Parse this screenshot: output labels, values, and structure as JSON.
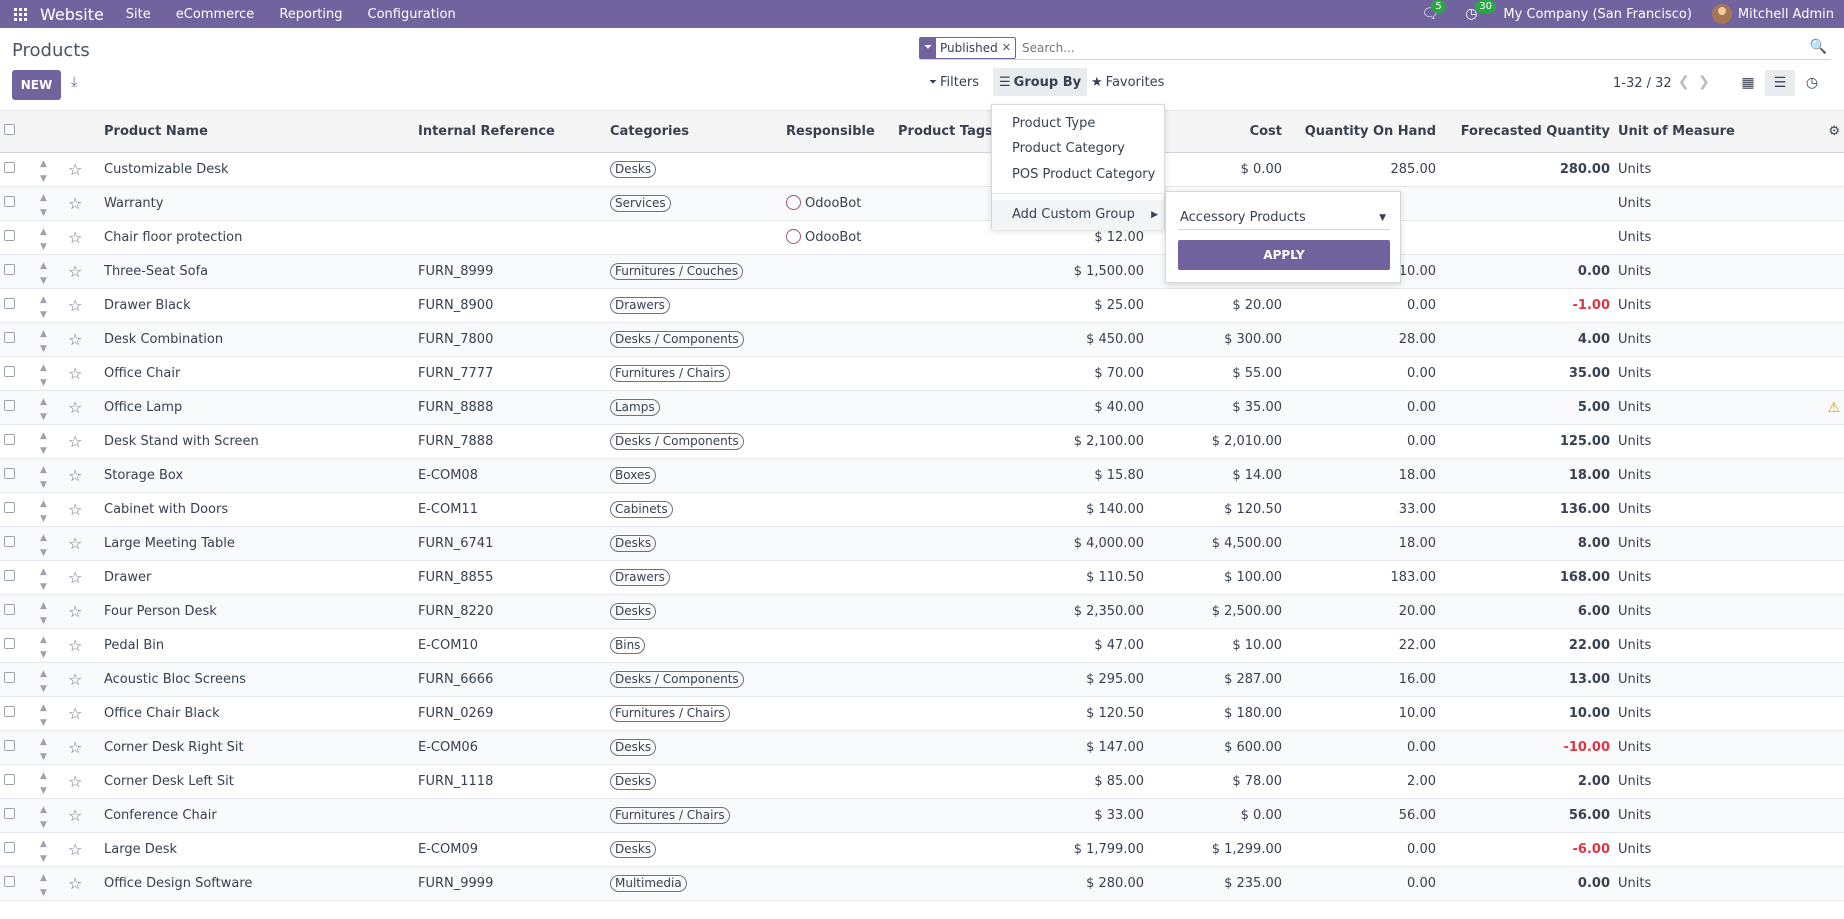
{
  "topbar": {
    "brand": "Website",
    "menus": [
      "Site",
      "eCommerce",
      "Reporting",
      "Configuration"
    ],
    "chat_count": "5",
    "activity_count": "30",
    "company": "My Company (San Francisco)",
    "user": "Mitchell Admin"
  },
  "control": {
    "title": "Products",
    "new_label": "NEW",
    "facet_label": "Published",
    "search_placeholder": "Search...",
    "filters_label": "Filters",
    "groupby_label": "Group By",
    "favorites_label": "Favorites",
    "pager": "1-32 / 32"
  },
  "columns": {
    "name": "Product Name",
    "ref": "Internal Reference",
    "categ": "Categories",
    "resp": "Responsible",
    "tags": "Product Tags",
    "cost": "Cost",
    "qty": "Quantity On Hand",
    "forecast": "Forecasted Quantity",
    "uom": "Unit of Measure"
  },
  "rows": [
    {
      "name": "Customizable Desk",
      "ref": "",
      "categ": "Desks",
      "resp": "",
      "price": "",
      "cost": "$ 0.00",
      "qty": "285.00",
      "forecast": "280.00",
      "fneg": false,
      "uom": "Units",
      "warn": false
    },
    {
      "name": "Warranty",
      "ref": "",
      "categ": "Services",
      "resp": "OdooBot",
      "price": "",
      "cost": "",
      "qty": "",
      "forecast": "",
      "fneg": false,
      "uom": "Units",
      "warn": false
    },
    {
      "name": "Chair floor protection",
      "ref": "",
      "categ": "",
      "resp": "OdooBot",
      "price": "$ 12.00",
      "cost": "",
      "qty": "",
      "forecast": "",
      "fneg": false,
      "uom": "Units",
      "warn": false
    },
    {
      "name": "Three-Seat Sofa",
      "ref": "FURN_8999",
      "categ": "Furnitures / Couches",
      "resp": "",
      "price": "$ 1,500.00",
      "cost": "",
      "qty": "10.00",
      "forecast": "0.00",
      "fneg": false,
      "uom": "Units",
      "warn": false
    },
    {
      "name": "Drawer Black",
      "ref": "FURN_8900",
      "categ": "Drawers",
      "resp": "",
      "price": "$ 25.00",
      "cost": "$ 20.00",
      "qty": "0.00",
      "forecast": "-1.00",
      "fneg": true,
      "uom": "Units",
      "warn": false
    },
    {
      "name": "Desk Combination",
      "ref": "FURN_7800",
      "categ": "Desks / Components",
      "resp": "",
      "price": "$ 450.00",
      "cost": "$ 300.00",
      "qty": "28.00",
      "forecast": "4.00",
      "fneg": false,
      "uom": "Units",
      "warn": false
    },
    {
      "name": "Office Chair",
      "ref": "FURN_7777",
      "categ": "Furnitures / Chairs",
      "resp": "",
      "price": "$ 70.00",
      "cost": "$ 55.00",
      "qty": "0.00",
      "forecast": "35.00",
      "fneg": false,
      "uom": "Units",
      "warn": false
    },
    {
      "name": "Office Lamp",
      "ref": "FURN_8888",
      "categ": "Lamps",
      "resp": "",
      "price": "$ 40.00",
      "cost": "$ 35.00",
      "qty": "0.00",
      "forecast": "5.00",
      "fneg": false,
      "uom": "Units",
      "warn": true
    },
    {
      "name": "Desk Stand with Screen",
      "ref": "FURN_7888",
      "categ": "Desks / Components",
      "resp": "",
      "price": "$ 2,100.00",
      "cost": "$ 2,010.00",
      "qty": "0.00",
      "forecast": "125.00",
      "fneg": false,
      "uom": "Units",
      "warn": false
    },
    {
      "name": "Storage Box",
      "ref": "E-COM08",
      "categ": "Boxes",
      "resp": "",
      "price": "$ 15.80",
      "cost": "$ 14.00",
      "qty": "18.00",
      "forecast": "18.00",
      "fneg": false,
      "uom": "Units",
      "warn": false
    },
    {
      "name": "Cabinet with Doors",
      "ref": "E-COM11",
      "categ": "Cabinets",
      "resp": "",
      "price": "$ 140.00",
      "cost": "$ 120.50",
      "qty": "33.00",
      "forecast": "136.00",
      "fneg": false,
      "uom": "Units",
      "warn": false
    },
    {
      "name": "Large Meeting Table",
      "ref": "FURN_6741",
      "categ": "Desks",
      "resp": "",
      "price": "$ 4,000.00",
      "cost": "$ 4,500.00",
      "qty": "18.00",
      "forecast": "8.00",
      "fneg": false,
      "uom": "Units",
      "warn": false
    },
    {
      "name": "Drawer",
      "ref": "FURN_8855",
      "categ": "Drawers",
      "resp": "",
      "price": "$ 110.50",
      "cost": "$ 100.00",
      "qty": "183.00",
      "forecast": "168.00",
      "fneg": false,
      "uom": "Units",
      "warn": false
    },
    {
      "name": "Four Person Desk",
      "ref": "FURN_8220",
      "categ": "Desks",
      "resp": "",
      "price": "$ 2,350.00",
      "cost": "$ 2,500.00",
      "qty": "20.00",
      "forecast": "6.00",
      "fneg": false,
      "uom": "Units",
      "warn": false
    },
    {
      "name": "Pedal Bin",
      "ref": "E-COM10",
      "categ": "Bins",
      "resp": "",
      "price": "$ 47.00",
      "cost": "$ 10.00",
      "qty": "22.00",
      "forecast": "22.00",
      "fneg": false,
      "uom": "Units",
      "warn": false
    },
    {
      "name": "Acoustic Bloc Screens",
      "ref": "FURN_6666",
      "categ": "Desks / Components",
      "resp": "",
      "price": "$ 295.00",
      "cost": "$ 287.00",
      "qty": "16.00",
      "forecast": "13.00",
      "fneg": false,
      "uom": "Units",
      "warn": false
    },
    {
      "name": "Office Chair Black",
      "ref": "FURN_0269",
      "categ": "Furnitures / Chairs",
      "resp": "",
      "price": "$ 120.50",
      "cost": "$ 180.00",
      "qty": "10.00",
      "forecast": "10.00",
      "fneg": false,
      "uom": "Units",
      "warn": false
    },
    {
      "name": "Corner Desk Right Sit",
      "ref": "E-COM06",
      "categ": "Desks",
      "resp": "",
      "price": "$ 147.00",
      "cost": "$ 600.00",
      "qty": "0.00",
      "forecast": "-10.00",
      "fneg": true,
      "uom": "Units",
      "warn": false
    },
    {
      "name": "Corner Desk Left Sit",
      "ref": "FURN_1118",
      "categ": "Desks",
      "resp": "",
      "price": "$ 85.00",
      "cost": "$ 78.00",
      "qty": "2.00",
      "forecast": "2.00",
      "fneg": false,
      "uom": "Units",
      "warn": false
    },
    {
      "name": "Conference Chair",
      "ref": "",
      "categ": "Furnitures / Chairs",
      "resp": "",
      "price": "$ 33.00",
      "cost": "$ 0.00",
      "qty": "56.00",
      "forecast": "56.00",
      "fneg": false,
      "uom": "Units",
      "warn": false
    },
    {
      "name": "Large Desk",
      "ref": "E-COM09",
      "categ": "Desks",
      "resp": "",
      "price": "$ 1,799.00",
      "cost": "$ 1,299.00",
      "qty": "0.00",
      "forecast": "-6.00",
      "fneg": true,
      "uom": "Units",
      "warn": false
    },
    {
      "name": "Office Design Software",
      "ref": "FURN_9999",
      "categ": "Multimedia",
      "resp": "",
      "price": "$ 280.00",
      "cost": "$ 235.00",
      "qty": "0.00",
      "forecast": "0.00",
      "fneg": false,
      "uom": "Units",
      "warn": false
    }
  ],
  "groupby_menu": {
    "items": [
      "Product Type",
      "Product Category",
      "POS Product Category"
    ],
    "custom_label": "Add Custom Group",
    "custom_value": "Accessory Products",
    "apply_label": "APPLY"
  }
}
